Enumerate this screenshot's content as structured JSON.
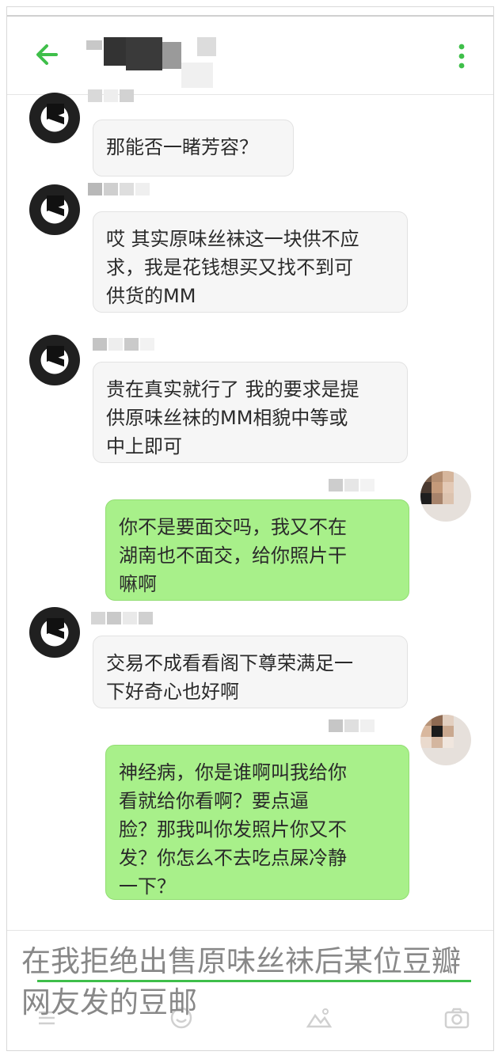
{
  "colors": {
    "accent": "#3fbf4a",
    "bubble_right": "#a8f08a",
    "bubble_left": "#f6f6f6"
  },
  "header": {
    "back_icon": "arrow-left-icon",
    "menu_icon": "more-vertical-icon"
  },
  "messages": [
    {
      "side": "left",
      "text": "那能否一睹芳容？"
    },
    {
      "side": "left",
      "text": "哎 其实原味丝袜这一块供不应\n求，我是花钱想买又找不到可\n供货的MM"
    },
    {
      "side": "left",
      "text": "贵在真实就行了 我的要求是提\n供原味丝袜的MM相貌中等或\n中上即可"
    },
    {
      "side": "right",
      "text": "你不是要面交吗，我又不在\n湖南也不面交，给你照片干\n嘛啊"
    },
    {
      "side": "left",
      "text": "交易不成看看阁下尊荣满足一\n下好奇心也好啊"
    },
    {
      "side": "right",
      "text": "神经病，你是谁啊叫我给你\n看就给你看啊？要点逼\n脸？那我叫你发照片你又不\n发？你怎么不去吃点屎冷静\n一下？"
    }
  ],
  "toolbar": {
    "icons": [
      "list-icon",
      "emoji-icon",
      "image-icon",
      "camera-icon"
    ]
  },
  "caption": "在我拒绝出售原味丝袜后某位豆瓣网友发的豆邮"
}
